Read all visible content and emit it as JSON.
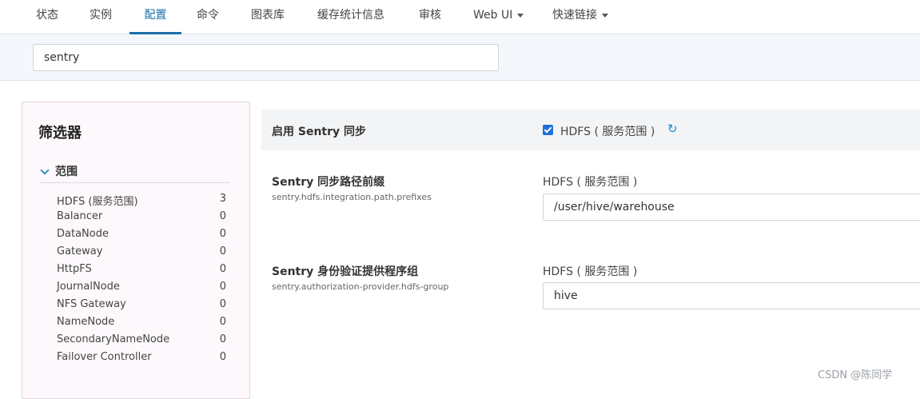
{
  "nav": {
    "tabs": [
      "状态",
      "实例",
      "配置",
      "命令",
      "图表库",
      "缓存统计信息",
      "审核",
      "Web UI",
      "快速链接"
    ]
  },
  "search": {
    "value": "sentry"
  },
  "filter": {
    "title": "筛选器",
    "scope_label": "范围",
    "items": [
      {
        "name": "HDFS (服务范围)",
        "count": "3"
      },
      {
        "name": "Balancer",
        "count": "0"
      },
      {
        "name": "DataNode",
        "count": "0"
      },
      {
        "name": "Gateway",
        "count": "0"
      },
      {
        "name": "HttpFS",
        "count": "0"
      },
      {
        "name": "JournalNode",
        "count": "0"
      },
      {
        "name": "NFS Gateway",
        "count": "0"
      },
      {
        "name": "NameNode",
        "count": "0"
      },
      {
        "name": "SecondaryNameNode",
        "count": "0"
      },
      {
        "name": "Failover Controller",
        "count": "0"
      }
    ]
  },
  "config": {
    "rows": [
      {
        "label": "启用 Sentry 同步",
        "scope": "HDFS ( 服务范围 )",
        "checked": true
      },
      {
        "label": "Sentry 同步路径前缀",
        "key": "sentry.hdfs.integration.path.prefixes",
        "scope": "HDFS ( 服务范围 )",
        "value": "/user/hive/warehouse"
      },
      {
        "label": "Sentry 身份验证提供程序组",
        "key": "sentry.authorization-provider.hdfs-group",
        "scope": "HDFS ( 服务范围 )",
        "value": "hive"
      }
    ]
  },
  "watermark": "CSDN @陈同学"
}
